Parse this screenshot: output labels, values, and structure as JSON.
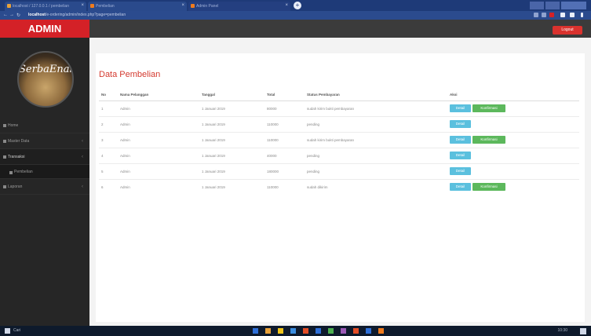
{
  "browser": {
    "tabs": [
      {
        "title": "localhost / 127.0.0.1 / pembelian",
        "color": "#e8a13a"
      },
      {
        "title": "Pembelian",
        "color": "#f07b1d"
      },
      {
        "title": "Admin Panel",
        "color": "#f07b1d"
      }
    ],
    "new_tab": "+",
    "url_host": "localhost",
    "url_path": "/e-ordering/admin/index.php?page=pembelian"
  },
  "header": {
    "brand": "ADMIN",
    "logout_label": "Logout"
  },
  "sidebar": {
    "logo_text": "SerbaEnak",
    "items": [
      {
        "label": "Home",
        "sub": false,
        "active": false,
        "caret": ""
      },
      {
        "label": "Master Data",
        "sub": false,
        "active": false,
        "caret": "‹"
      },
      {
        "label": "Transaksi",
        "sub": false,
        "active": true,
        "caret": "‹"
      },
      {
        "label": "Pembelian",
        "sub": true,
        "active": false,
        "caret": ""
      },
      {
        "label": "Laporan",
        "sub": false,
        "active": false,
        "caret": "‹"
      }
    ]
  },
  "main": {
    "title": "Data Pembelian",
    "columns": [
      "No",
      "Nama Pelanggan",
      "Tanggal",
      "Total",
      "Status Pembayaran",
      "Aksi"
    ],
    "rows": [
      {
        "no": "1",
        "nama": "Admin",
        "tanggal": "1 Januari 2019",
        "total": "80000",
        "status": "sudah kirim bukti pembayaran",
        "confirm": true
      },
      {
        "no": "2",
        "nama": "Admin",
        "tanggal": "1 Januari 2019",
        "total": "110000",
        "status": "pending",
        "confirm": false
      },
      {
        "no": "3",
        "nama": "Admin",
        "tanggal": "1 Januari 2019",
        "total": "110000",
        "status": "sudah kirim bukti pembayaran",
        "confirm": true
      },
      {
        "no": "4",
        "nama": "Admin",
        "tanggal": "1 Januari 2019",
        "total": "40000",
        "status": "pending",
        "confirm": false
      },
      {
        "no": "5",
        "nama": "Admin",
        "tanggal": "1 Januari 2019",
        "total": "180000",
        "status": "pending",
        "confirm": false
      },
      {
        "no": "6",
        "nama": "Admin",
        "tanggal": "1 Januari 2019",
        "total": "110000",
        "status": "sudah dikirim",
        "confirm": true
      }
    ],
    "detail_label": "Detail",
    "confirm_label": "Konfirmasi"
  },
  "taskbar": {
    "search_label": "Cari",
    "tray_time": "10:30",
    "icons": [
      "#2e6fd8",
      "#e8a13a",
      "#f0c419",
      "#3a8de0",
      "#e34d26",
      "#2e6fd8",
      "#4caf50",
      "#9b59b6",
      "#e34d26",
      "#2e6fd8",
      "#f07b1d"
    ]
  }
}
